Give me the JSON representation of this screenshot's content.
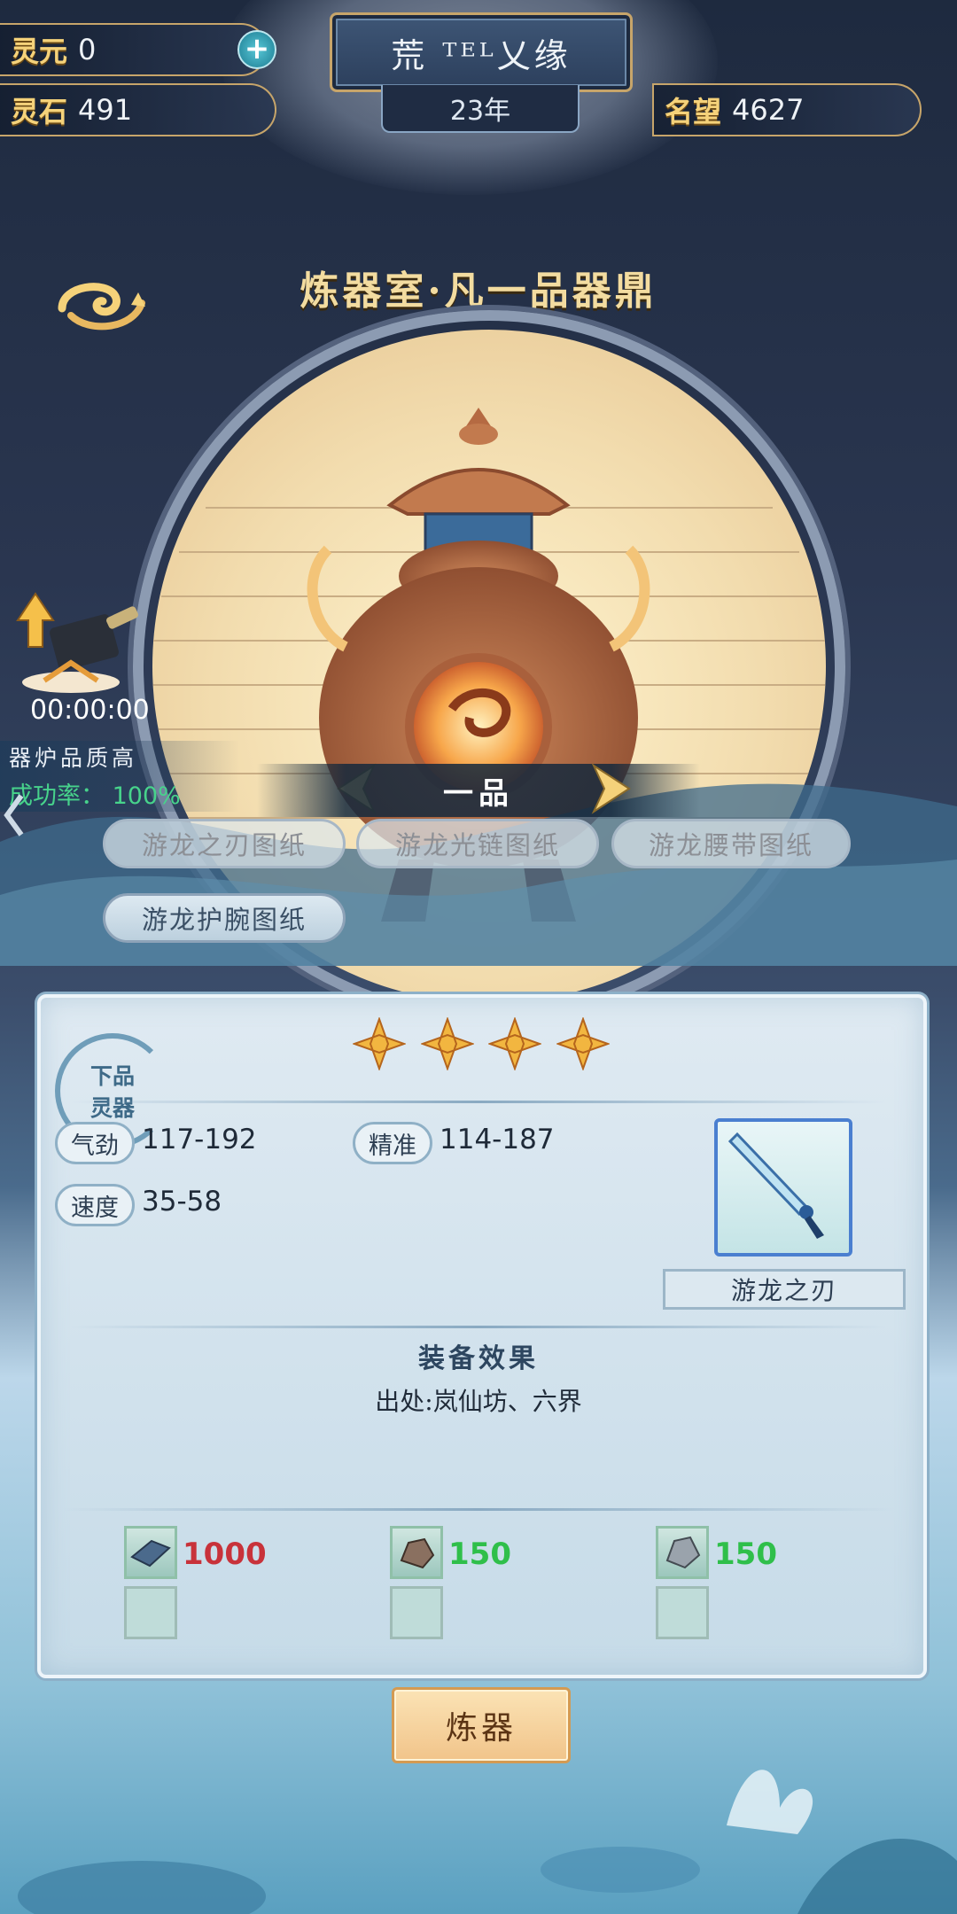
{
  "resources": {
    "lingyuan_label": "灵元",
    "lingyuan_value": "0",
    "lingshi_label": "灵石",
    "lingshi_value": "491",
    "fame_label": "名望",
    "fame_value": "4627"
  },
  "header": {
    "game_title": "荒 ᵀᴱᴸ乂缘",
    "year": "23年"
  },
  "room": {
    "title": "炼器室·凡一品器鼎",
    "timer": "00:00:00",
    "furnace_quality": "器炉品质高",
    "success_rate_label": "成功率：",
    "success_rate": "100%",
    "grade": "一品"
  },
  "recipes": [
    {
      "label": "游龙之刃图纸",
      "active": false
    },
    {
      "label": "游龙光链图纸",
      "active": false
    },
    {
      "label": "游龙腰带图纸",
      "active": false
    },
    {
      "label": "游龙护腕图纸",
      "active": true
    }
  ],
  "item": {
    "rank_line1": "下品",
    "rank_line2": "灵器",
    "star_count": 4,
    "stats": [
      {
        "label": "气劲",
        "value": "117-192"
      },
      {
        "label": "精准",
        "value": "114-187"
      },
      {
        "label": "速度",
        "value": "35-58"
      }
    ],
    "name": "游龙之刃",
    "effect_title": "装备效果",
    "source": "出处:岚仙坊、六界"
  },
  "materials": [
    {
      "icon": "iron-ingot-icon",
      "amount": "1000",
      "color": "#c8323a"
    },
    {
      "icon": "ore-stone-icon",
      "amount": "150",
      "color": "#2fbf4a"
    },
    {
      "icon": "silver-ore-icon",
      "amount": "150",
      "color": "#2fbf4a"
    }
  ],
  "actions": {
    "forge_label": "炼器"
  },
  "colors": {
    "gold": "#f5d27a",
    "success_green": "#47d38b",
    "insufficient_red": "#c8323a",
    "sufficient_green": "#2fbf4a",
    "selected_border": "#4a7fd0"
  }
}
